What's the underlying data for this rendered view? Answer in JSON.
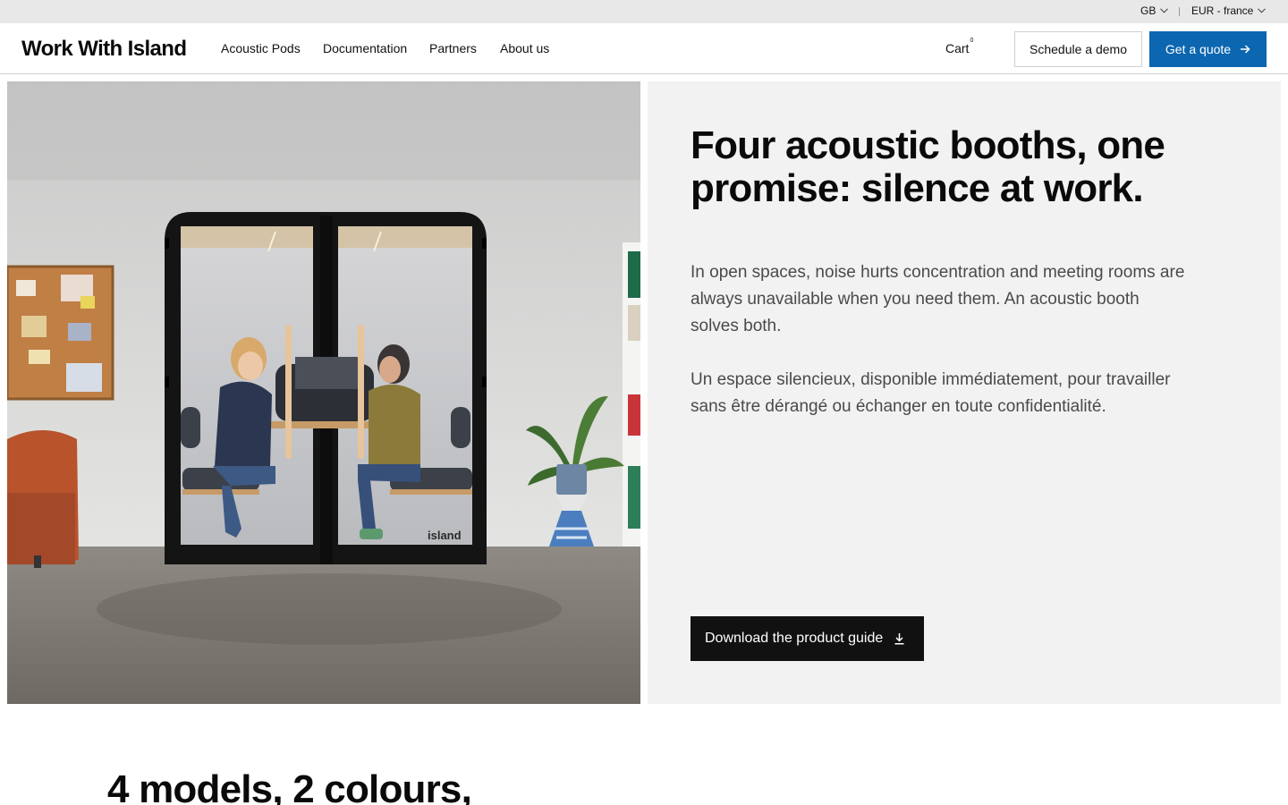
{
  "topbar": {
    "language": "GB",
    "currency": "EUR - france"
  },
  "header": {
    "logo": "Work With Island",
    "nav": [
      {
        "label": "Acoustic Pods"
      },
      {
        "label": "Documentation"
      },
      {
        "label": "Partners"
      },
      {
        "label": "About us"
      }
    ],
    "cart_label": "Cart",
    "cart_count": "0",
    "demo_button": "Schedule a demo",
    "quote_button": "Get a quote"
  },
  "hero": {
    "image_brand_text": "island",
    "title": "Four acoustic booths, one promise: silence at work.",
    "paragraph_en": "In open spaces, noise hurts concentration and meeting rooms are always unavailable when you need them. An acoustic booth solves both.",
    "paragraph_fr": "Un espace silencieux, disponible immédiatement, pour travailler sans être dérangé ou échanger en toute confidentialité.",
    "guide_button": "Download the product guide"
  },
  "models_section": {
    "title": "4 models, 2 colours,"
  },
  "colors": {
    "accent": "#0c66b0",
    "dark_button": "#111111",
    "panel_bg": "#f2f2f2",
    "topbar_bg": "#e8e8e8"
  }
}
